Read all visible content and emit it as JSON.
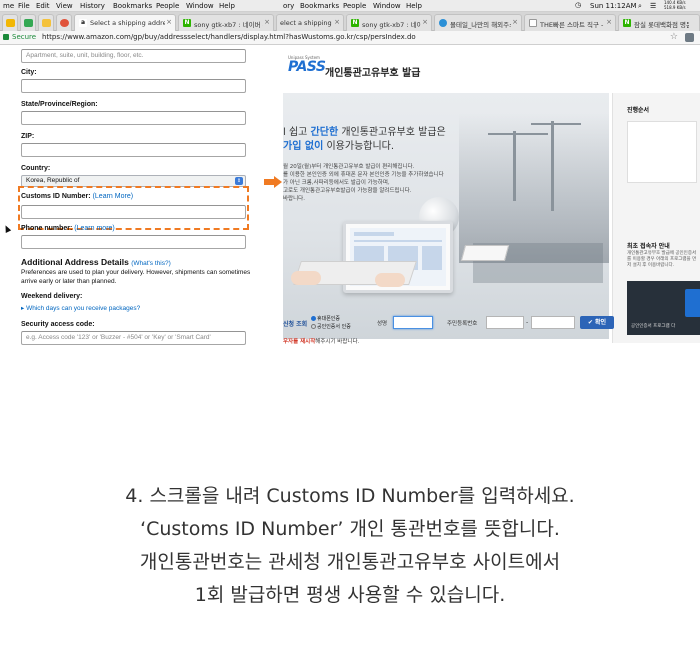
{
  "menubar": {
    "left_items": [
      "me",
      "File",
      "Edit",
      "View",
      "History",
      "Bookmarks",
      "People",
      "Window",
      "Help"
    ],
    "right_items": [
      "ory",
      "Bookmarks",
      "People",
      "Window",
      "Help"
    ],
    "clock": "Sun 11:12AM",
    "net_up": "140.4 KB/s",
    "net_down": "518.9 KB/s"
  },
  "tabs": [
    {
      "label": "Select a shipping address",
      "active": true,
      "fav": "a",
      "color": "#ffffff"
    },
    {
      "label": "sony gtk-xb7 : 네이버 통합검색",
      "active": false,
      "fav": "N",
      "color": "#2db400"
    },
    {
      "label": "elect a shipping addr",
      "active": false,
      "fav": "",
      "color": "#d0d0d0"
    },
    {
      "label": "sony gtk-xb7 : 네이버 통",
      "active": false,
      "fav": "N",
      "color": "#2db400"
    },
    {
      "label": "몰테일_나만의 해외주소드",
      "active": false,
      "fav": "",
      "color": "#2a8fd6"
    },
    {
      "label": "THE빠른 스마트 직구 - ©",
      "active": false,
      "fav": "",
      "color": "#9a9a9a"
    },
    {
      "label": "잠실 롯데백화점 명문주스",
      "active": false,
      "fav": "N",
      "color": "#2db400"
    }
  ],
  "address_bar": {
    "secure_label": "Secure",
    "url": "https://www.amazon.com/gp/buy/addressselect/handlers/display.html?hasWustoms.go.kr/csp/persIndex.do"
  },
  "form": {
    "address2_placeholder": "Apartment, suite, unit, building, floor, etc.",
    "city_label": "City:",
    "state_label": "State/Province/Region:",
    "zip_label": "ZIP:",
    "country_label": "Country:",
    "country_value": "Korea, Republic of",
    "customs_label": "Customs ID Number:",
    "customs_learn_more": "(Learn More)",
    "phone_label": "Phone number:",
    "phone_learn_more": "(Learn more)",
    "additional_title": "Additional Address Details",
    "whats_this": "(What's this?)",
    "preferences_text": "Preferences are used to plan your delivery. However, shipments can sometimes arrive early or later than planned.",
    "weekend_label": "Weekend delivery:",
    "weekend_link": "▸ Which days can you receive packages?",
    "security_label": "Security access code:",
    "security_placeholder": "e.g. Access code '123' or 'Buzzer - #504' or 'Key' or 'Smart Card'"
  },
  "customs_site": {
    "logo": "PASS",
    "logo_small": "Unipass System",
    "title": "개인통관고유부호 발급",
    "headline_pre": "l 쉽고 ",
    "headline_accent": "간단한",
    "headline_post": " 개인통관고유부호 발급은",
    "headline2_accent": "가입 없이",
    "headline2_post": " 이용가능합니다.",
    "desc_lines": [
      "월 20일(월)부터 개인통관고유부호 발급이 편리해집니다.",
      "를 이용한 본인인증 외에 휴대폰 문자 본인인증 기능을 추가하였습니다",
      "가 아닌 크롬,사파리등에서도 발급이 가능하며,",
      "고로도 개인통관고유부호발급이 가능함을 알려드립니다.",
      "바랍니다."
    ],
    "panel_step_title": "진행순서",
    "panel_guide_title": "최초 접속자 안내",
    "panel_guide_text": "개인통관고유부호 발급에 공인인증서를 이용할 경우 아래의 프로그램을 먼저 설치 후 이용바랍니다.",
    "panel_program": "공인인증서 프로그램 다",
    "search_title": "신청 조회",
    "radio_phone": "휴대폰인증",
    "radio_cert": "공인인증서 인증",
    "name_label": "성명",
    "id_label": "주민등록번호",
    "confirm_label": "✔ 확인",
    "notice_bold": "우자를 재시작",
    "notice_rest": "해주시기 바랍니다."
  },
  "caption": [
    "4. 스크롤을 내려 Customs ID Number를 입력하세요.",
    "‘Customs ID Number’ 개인 통관번호를 뜻합니다.",
    "개인통관번호는 관세청 개인통관고유부호 사이트에서",
    "1회 발급하면 평생 사용할 수 있습니다."
  ],
  "colors": {
    "highlight": "#f07a22",
    "amazon_link": "#0066c0",
    "unipass_blue": "#1f6fd1"
  }
}
